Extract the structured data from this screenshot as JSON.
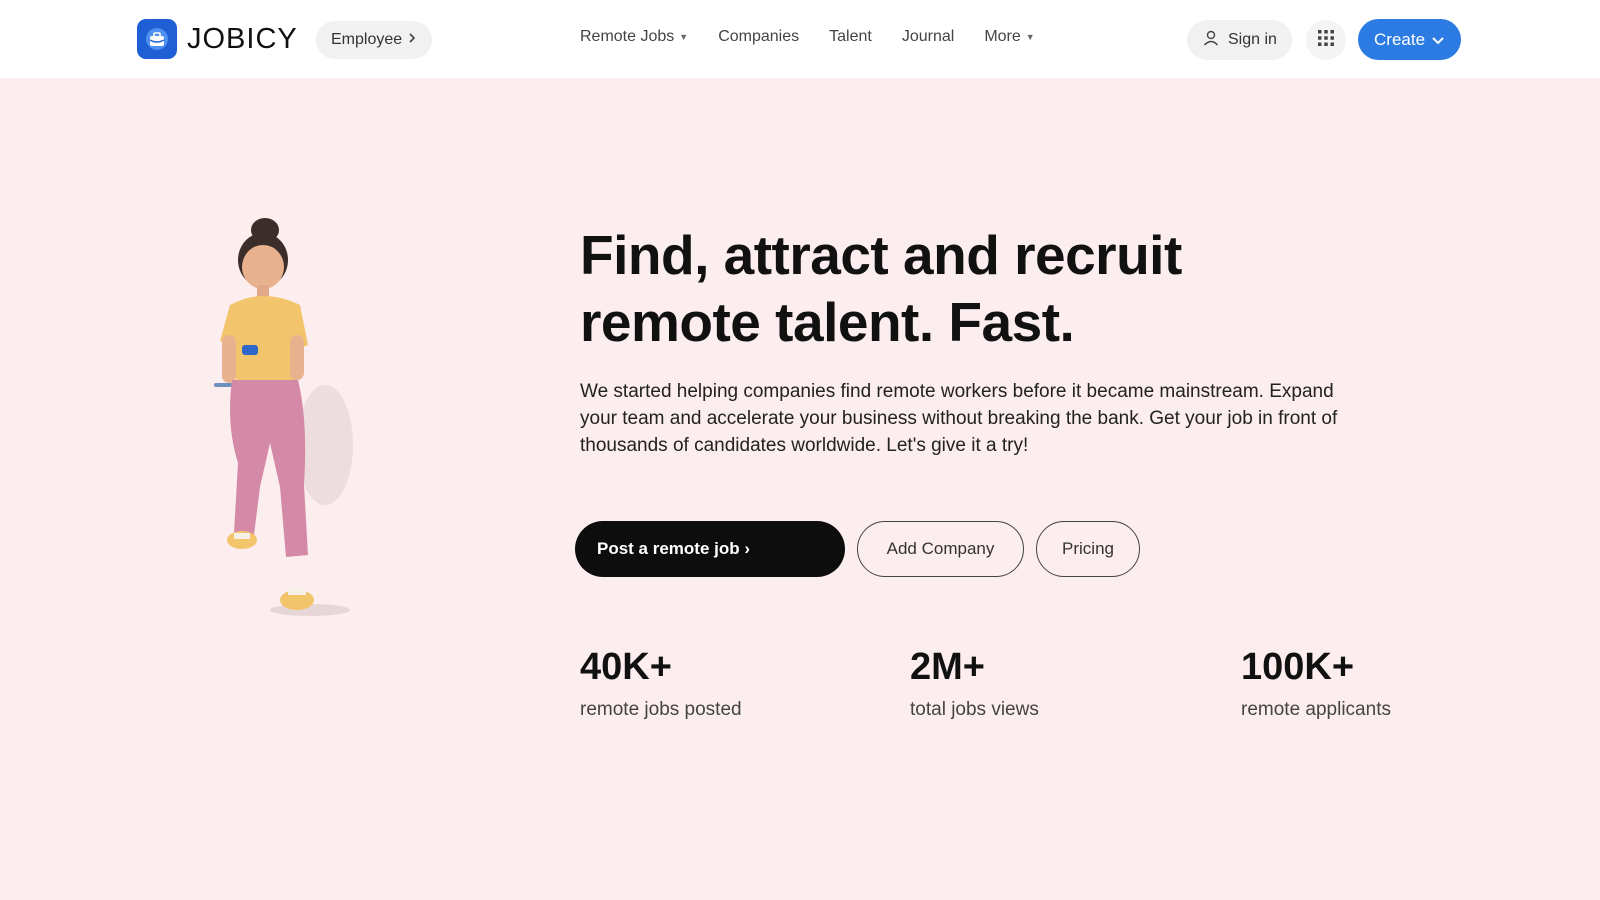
{
  "header": {
    "brand": "JOBICY",
    "employee_label": "Employee",
    "nav": [
      {
        "label": "Remote Jobs",
        "has_caret": true
      },
      {
        "label": "Companies",
        "has_caret": false
      },
      {
        "label": "Talent",
        "has_caret": false
      },
      {
        "label": "Journal",
        "has_caret": false
      },
      {
        "label": "More",
        "has_caret": true
      }
    ],
    "signin_label": "Sign in",
    "create_label": "Create"
  },
  "hero": {
    "title_line1": "Find, attract and recruit",
    "title_line2": "remote talent. Fast.",
    "description": "We started helping companies find remote workers before it became mainstream. Expand your team and accelerate your business without breaking the bank. Get your job in front of thousands of candidates worldwide. Let's give it a try!",
    "primary_button": "Post a remote job ›",
    "add_company_button": "Add Company",
    "pricing_button": "Pricing"
  },
  "stats": [
    {
      "value": "40K+",
      "label": "remote jobs posted"
    },
    {
      "value": "2M+",
      "label": "total jobs views"
    },
    {
      "value": "100K+",
      "label": "remote applicants"
    }
  ],
  "icons": {
    "logo": "briefcase-logo-icon",
    "employee_chevron": "chevron-right-icon",
    "signin": "user-icon",
    "apps": "grid-icon",
    "create_chevron": "chevron-down-icon"
  },
  "colors": {
    "background": "#fcedee",
    "header_bg": "#ffffff",
    "accent": "#2b7be3",
    "brand_blue": "#1f5fd6",
    "primary_button": "#0d0d0d"
  }
}
